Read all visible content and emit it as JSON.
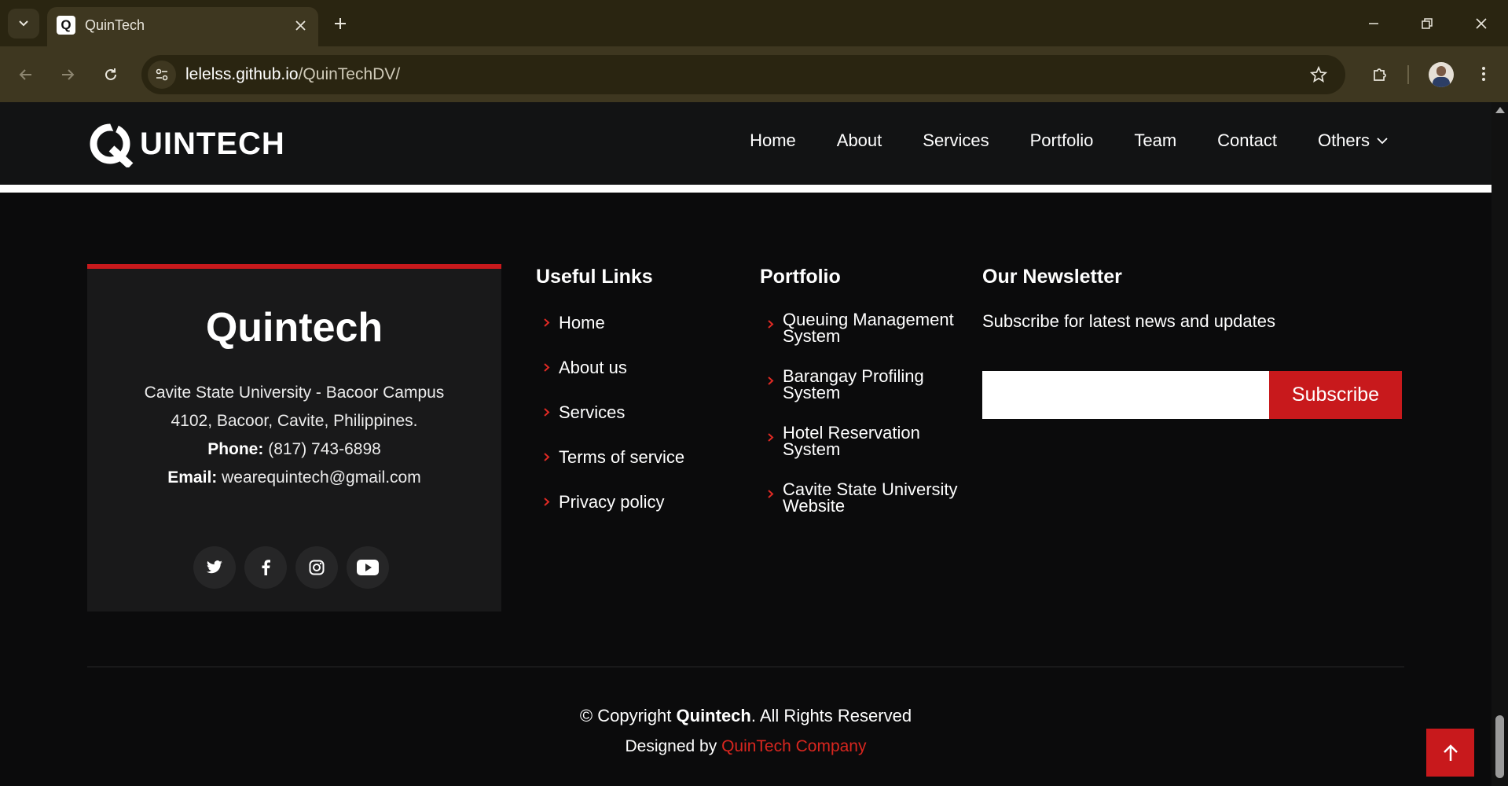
{
  "browser": {
    "tab_title": "QuinTech",
    "url_host": "lelelss.github.io",
    "url_path": "/QuinTechDV/"
  },
  "header": {
    "logo_text": "UINTECH",
    "nav": [
      "Home",
      "About",
      "Services",
      "Portfolio",
      "Team",
      "Contact",
      "Others"
    ]
  },
  "contact_card": {
    "title": "Quintech",
    "address_line1": "Cavite State University - Bacoor Campus",
    "address_line2": "4102, Bacoor, Cavite, Philippines.",
    "phone_label": "Phone:",
    "phone": "(817) 743-6898",
    "email_label": "Email:",
    "email": "wearequintech@gmail.com",
    "socials": [
      "twitter-icon",
      "facebook-icon",
      "instagram-icon",
      "youtube-icon"
    ]
  },
  "useful_links": {
    "title": "Useful Links",
    "items": [
      "Home",
      "About us",
      "Services",
      "Terms of service",
      "Privacy policy"
    ]
  },
  "portfolio": {
    "title": "Portfolio",
    "items": [
      [
        "Queuing Management",
        "System"
      ],
      [
        "Barangay Profiling",
        "System"
      ],
      [
        "Hotel Reservation",
        "System"
      ],
      [
        "Cavite State University",
        "Website"
      ]
    ]
  },
  "newsletter": {
    "title": "Our Newsletter",
    "text": "Subscribe for latest news and updates",
    "input_value": "",
    "button": "Subscribe"
  },
  "footer": {
    "copyright_prefix": "© Copyright ",
    "copyright_brand": "Quintech",
    "copyright_suffix": ". All Rights Reserved",
    "designed_prefix": "Designed by ",
    "designed_company": "QuinTech Company"
  },
  "colors": {
    "accent_red": "#c8191c",
    "background": "#0b0b0c",
    "chrome": "#3e3720"
  }
}
